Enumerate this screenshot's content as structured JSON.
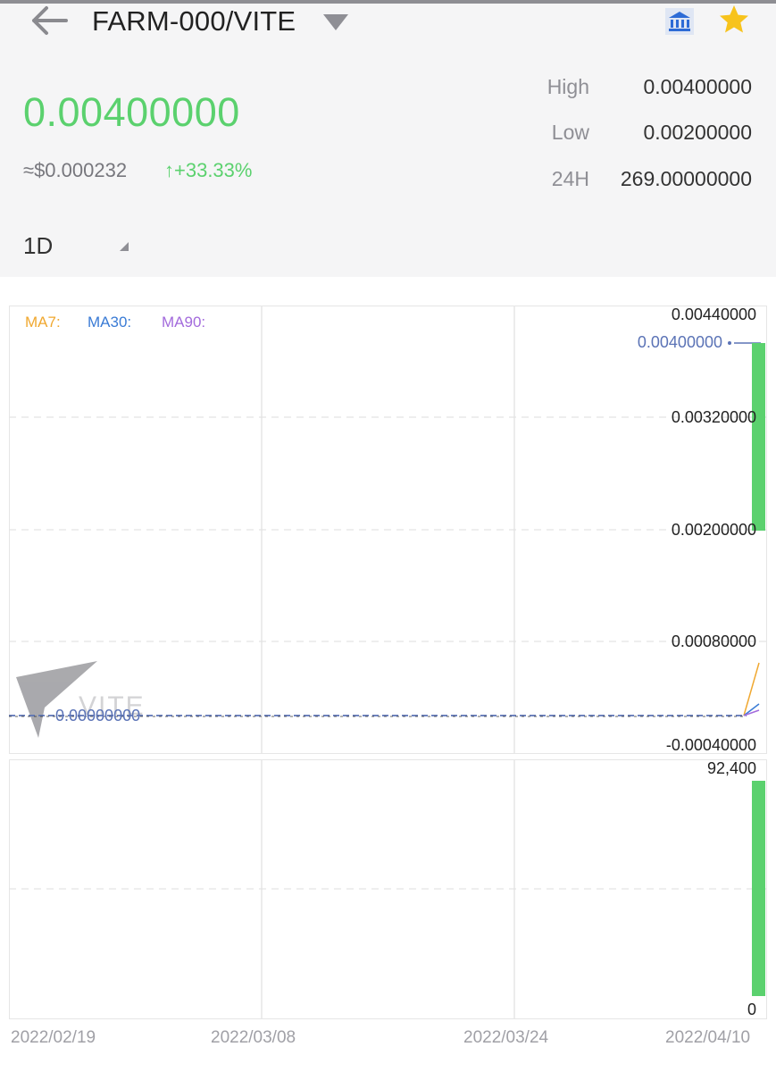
{
  "header": {
    "pair": "FARM-000/VITE",
    "price": "0.00400000",
    "usd_price": "≈$0.000232",
    "change": "↑+33.33%",
    "stats": [
      {
        "label": "High",
        "value": "0.00400000"
      },
      {
        "label": "Low",
        "value": "0.00200000"
      },
      {
        "label": "24H",
        "value": "269.00000000"
      }
    ],
    "interval": "1D"
  },
  "chart": {
    "ma_legend": [
      {
        "label": "MA7:",
        "color": "#f0a830"
      },
      {
        "label": "MA30:",
        "color": "#3a7bd5"
      },
      {
        "label": "MA90:",
        "color": "#a36bdc"
      }
    ],
    "price_axis": [
      "0.00440000",
      "0.00320000",
      "0.00200000",
      "0.00080000",
      "-0.00040000"
    ],
    "current_price_label": "0.00400000",
    "zero_label": "0.00000000",
    "volume_axis": [
      "92,400",
      "0"
    ],
    "x_axis": [
      "2022/02/19",
      "2022/03/08",
      "2022/03/24",
      "2022/04/10"
    ],
    "watermark_text": "VITE"
  },
  "colors": {
    "up": "#5bd16e",
    "grid": "#e6e6e6",
    "price_line": "#5b73b6"
  },
  "icons": [
    "back-arrow-icon",
    "caret-down-icon",
    "bank-icon",
    "star-icon",
    "caret-down-small-icon",
    "vite-logo"
  ]
}
